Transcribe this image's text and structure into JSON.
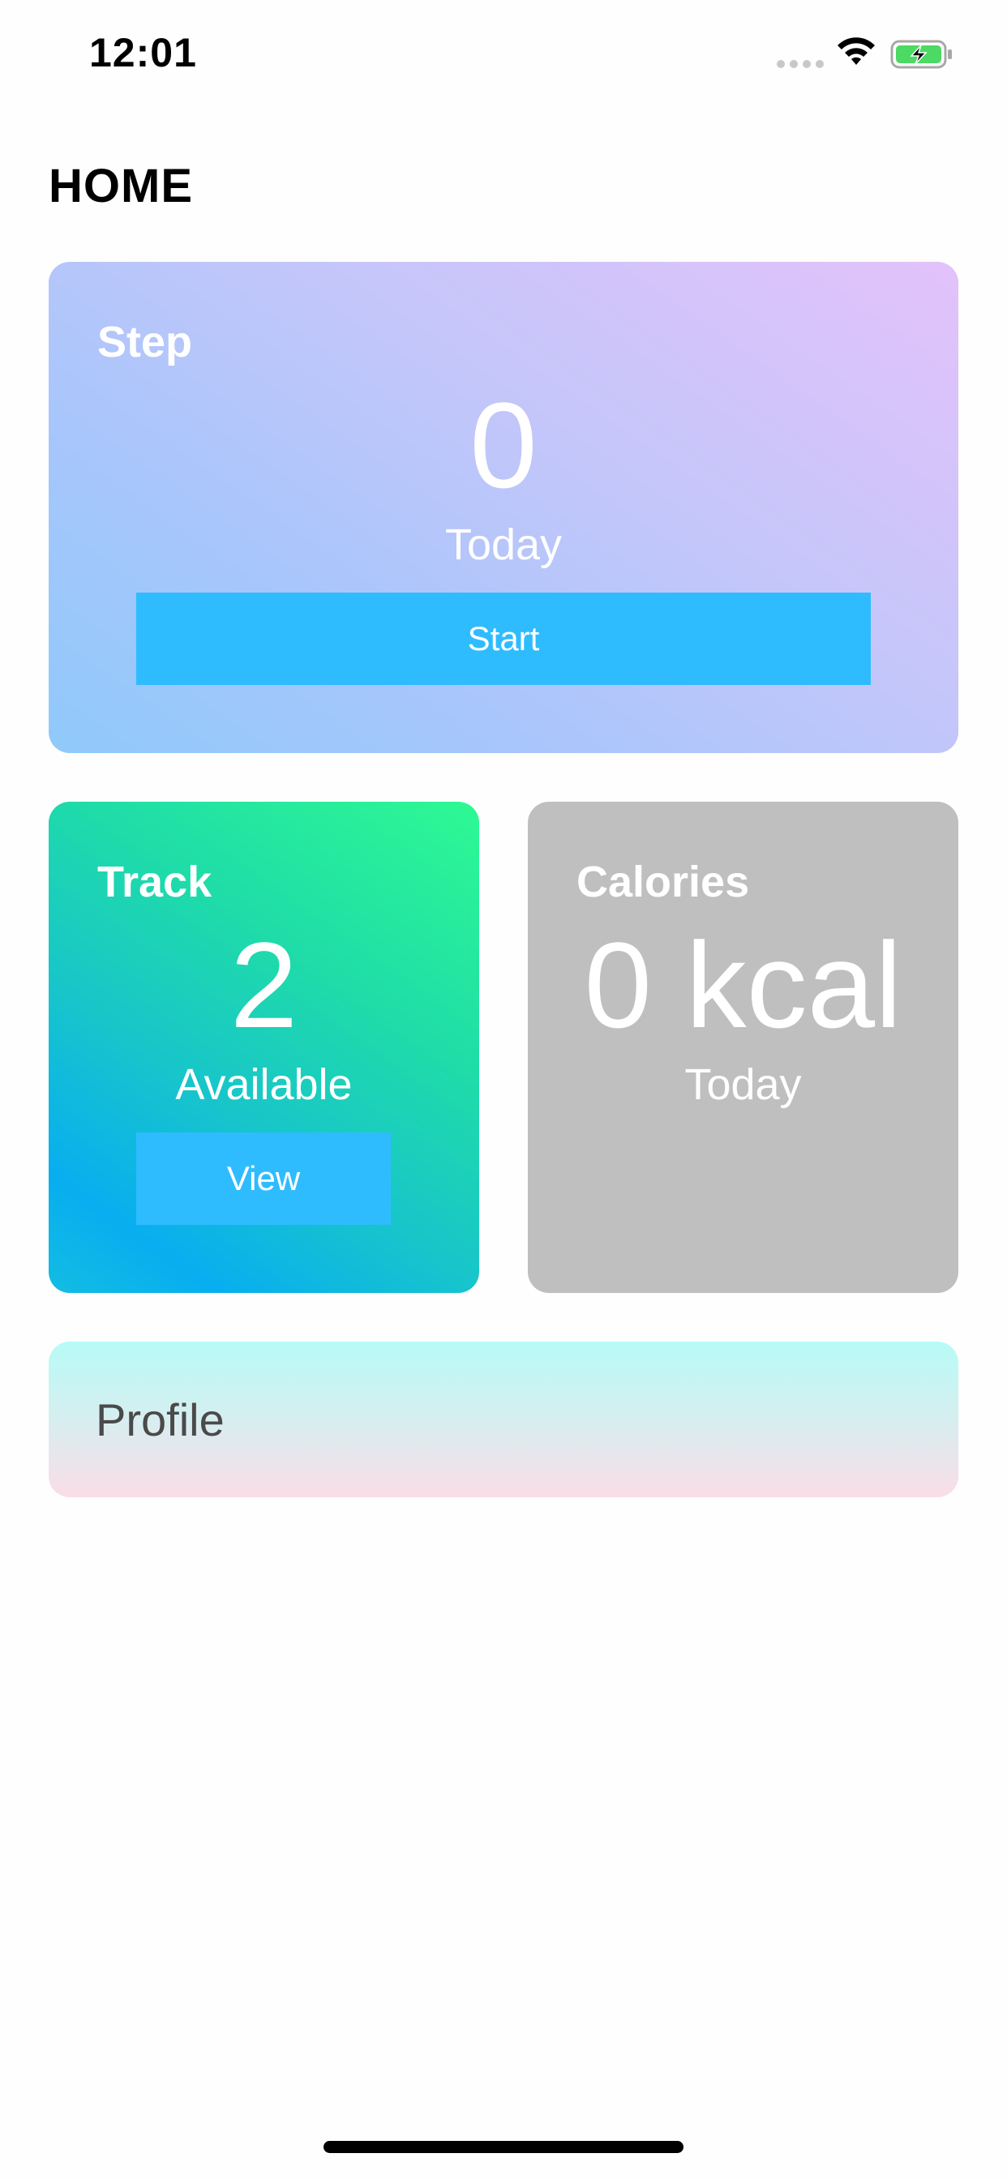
{
  "status_bar": {
    "time": "12:01",
    "icons": [
      "signal-dots-icon",
      "wifi-icon",
      "battery-charging-icon"
    ],
    "battery_color": "#4cd964"
  },
  "header": {
    "title": "HOME"
  },
  "step_card": {
    "title": "Step",
    "value": "0",
    "label": "Today",
    "button_label": "Start",
    "button_color": "#2fbcff"
  },
  "track_card": {
    "title": "Track",
    "value": "2",
    "label": "Available",
    "button_label": "View",
    "button_color": "#2fbcff"
  },
  "calories_card": {
    "title": "Calories",
    "value": "0 kcal",
    "label": "Today",
    "background": "#bfbfbf"
  },
  "profile_card": {
    "label": "Profile"
  }
}
